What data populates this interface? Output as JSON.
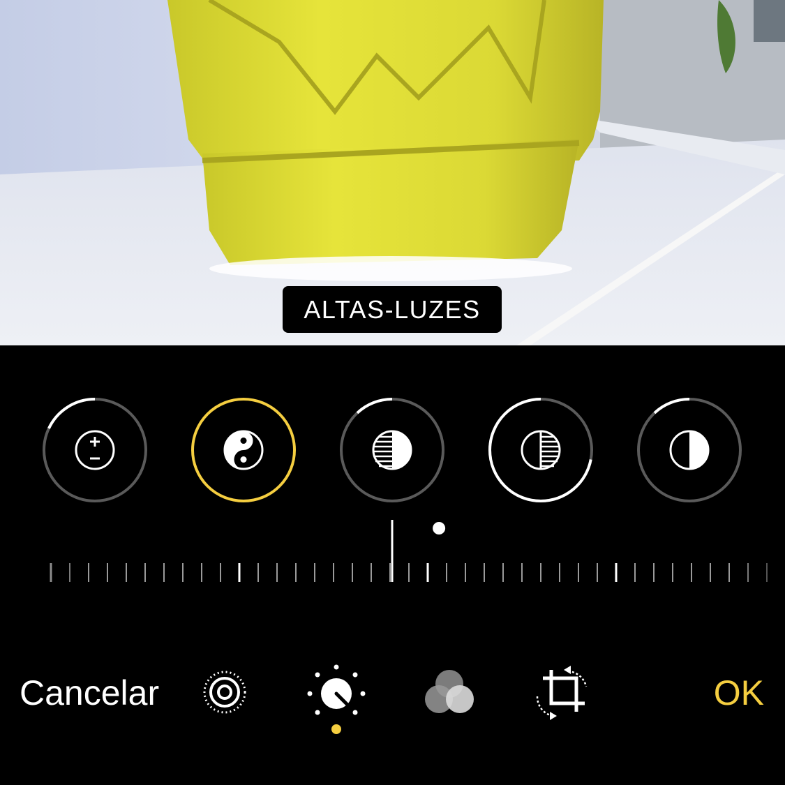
{
  "tool_label": "ALTAS-LUZES",
  "adjustments": [
    {
      "name": "exposure",
      "value": 0.18,
      "selected": false
    },
    {
      "name": "highlights",
      "value": 1.0,
      "selected": true
    },
    {
      "name": "shadows",
      "value": 0.12,
      "selected": false
    },
    {
      "name": "contrast",
      "value": 0.72,
      "selected": false
    },
    {
      "name": "brightness",
      "value": 0.12,
      "selected": false
    }
  ],
  "slider": {
    "value_fraction": 0.555
  },
  "bottom_bar": {
    "cancel_label": "Cancelar",
    "ok_label": "OK",
    "tools": [
      "live-photo-icon",
      "adjust-icon",
      "filters-icon",
      "crop-rotate-icon"
    ],
    "active_tool": "adjust-icon"
  },
  "colors": {
    "accent": "#f5ce40",
    "ring_track": "#5a5a5a",
    "background": "#000000"
  }
}
